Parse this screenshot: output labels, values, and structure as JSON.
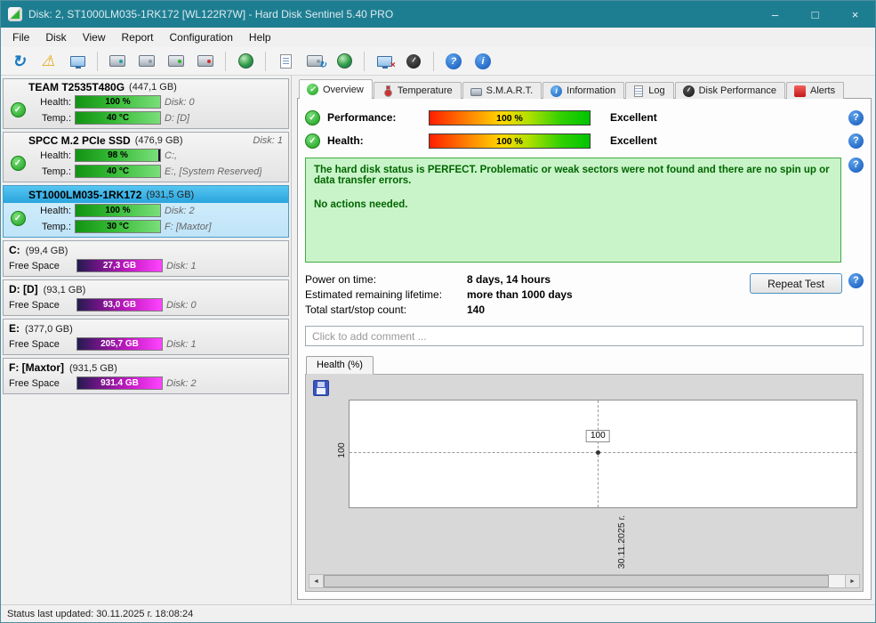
{
  "window": {
    "title": "Disk: 2, ST1000LM035-1RK172 [WL122R7W]  -  Hard Disk Sentinel 5.40 PRO",
    "minimize": "–",
    "maximize": "□",
    "close": "×"
  },
  "menu": {
    "items": [
      "File",
      "Disk",
      "View",
      "Report",
      "Configuration",
      "Help"
    ]
  },
  "toolbar": {
    "icons": [
      "refresh",
      "disk-test-warning",
      "report-monitor",
      "detect-disk",
      "disk",
      "disk-online",
      "disk-remove",
      "network-globe",
      "report-document",
      "disk-refresh",
      "web-report",
      "remote-monitor",
      "performance-gauge",
      "help",
      "information"
    ]
  },
  "icons": {
    "check": "✓",
    "refresh": "↻",
    "warning": "⚠",
    "help": "?",
    "info": "i",
    "scroll_left": "◄",
    "scroll_right": "►"
  },
  "labels": {
    "health": "Health:",
    "temp": "Temp.:",
    "free_space": "Free Space"
  },
  "sidebar": {
    "disks": [
      {
        "name": "TEAM T2535T480G",
        "size": "(447,1 GB)",
        "name_right": "",
        "health": "100 %",
        "health_pct": 100,
        "health_right": "Disk: 0",
        "temp": "40 °C",
        "temp_pct": 100,
        "temp_right": "D: [D]"
      },
      {
        "name": "SPCC M.2 PCIe SSD",
        "size": "(476,9 GB)",
        "name_right": "Disk: 1",
        "health": "98 %",
        "health_pct": 98,
        "health_right": "C:,",
        "temp": "40 °C",
        "temp_pct": 100,
        "temp_right": "E:,  [System Reserved]"
      },
      {
        "name": "ST1000LM035-1RK172",
        "size": "(931,5 GB)",
        "name_right": "",
        "health": "100 %",
        "health_pct": 100,
        "health_right": "Disk: 2",
        "temp": "30 °C",
        "temp_pct": 100,
        "temp_right": "F: [Maxtor]"
      }
    ],
    "partitions": [
      {
        "name": "C:",
        "size": "(99,4 GB)",
        "free": "27,3 GB",
        "free_pct": 100,
        "right": "Disk: 1"
      },
      {
        "name": "D: [D]",
        "size": "(93,1 GB)",
        "free": "93,0 GB",
        "free_pct": 100,
        "right": "Disk: 0"
      },
      {
        "name": "E:",
        "size": "(377,0 GB)",
        "free": "205,7 GB",
        "free_pct": 100,
        "right": "Disk: 1"
      },
      {
        "name": "F: [Maxtor]",
        "size": "(931,5 GB)",
        "free": "931.4 GB",
        "free_pct": 100,
        "right": "Disk: 2"
      }
    ]
  },
  "tabs": [
    {
      "label": "Overview"
    },
    {
      "label": "Temperature"
    },
    {
      "label": "S.M.A.R.T."
    },
    {
      "label": "Information"
    },
    {
      "label": "Log"
    },
    {
      "label": "Disk Performance"
    },
    {
      "label": "Alerts"
    }
  ],
  "overview": {
    "performance_label": "Performance:",
    "performance_value": "100 %",
    "performance_pct": 100,
    "performance_rating": "Excellent",
    "health_label": "Health:",
    "health_value": "100 %",
    "health_pct": 100,
    "health_rating": "Excellent",
    "status_line1": "The hard disk status is PERFECT. Problematic or weak sectors were not found and there are no spin up or data transfer errors.",
    "status_line2": "No actions needed.",
    "info": [
      {
        "label": "Power on time:",
        "value": "8 days, 14 hours"
      },
      {
        "label": "Estimated remaining lifetime:",
        "value": "more than 1000 days"
      },
      {
        "label": "Total start/stop count:",
        "value": "140"
      }
    ],
    "repeat_test": "Repeat Test",
    "comment_placeholder": "Click to add comment ...",
    "chart": {
      "tab_label": "Health (%)",
      "y_label": "100",
      "point_label": "100",
      "x_label": "30.11.2025 г.",
      "point_value": 100,
      "point_date": "30.11.2025"
    }
  },
  "status_bar": {
    "text": "Status last updated: 30.11.2025 г. 18:08:24"
  },
  "colors": {
    "titlebar": "#1e7e91",
    "selection_header": "#3bb4e9",
    "selection_body": "#c9e9fb",
    "health_green": "#2db42d",
    "free_magenta": "#e424d6",
    "status_box_bg": "#c9f4c9",
    "status_text": "#006600"
  }
}
